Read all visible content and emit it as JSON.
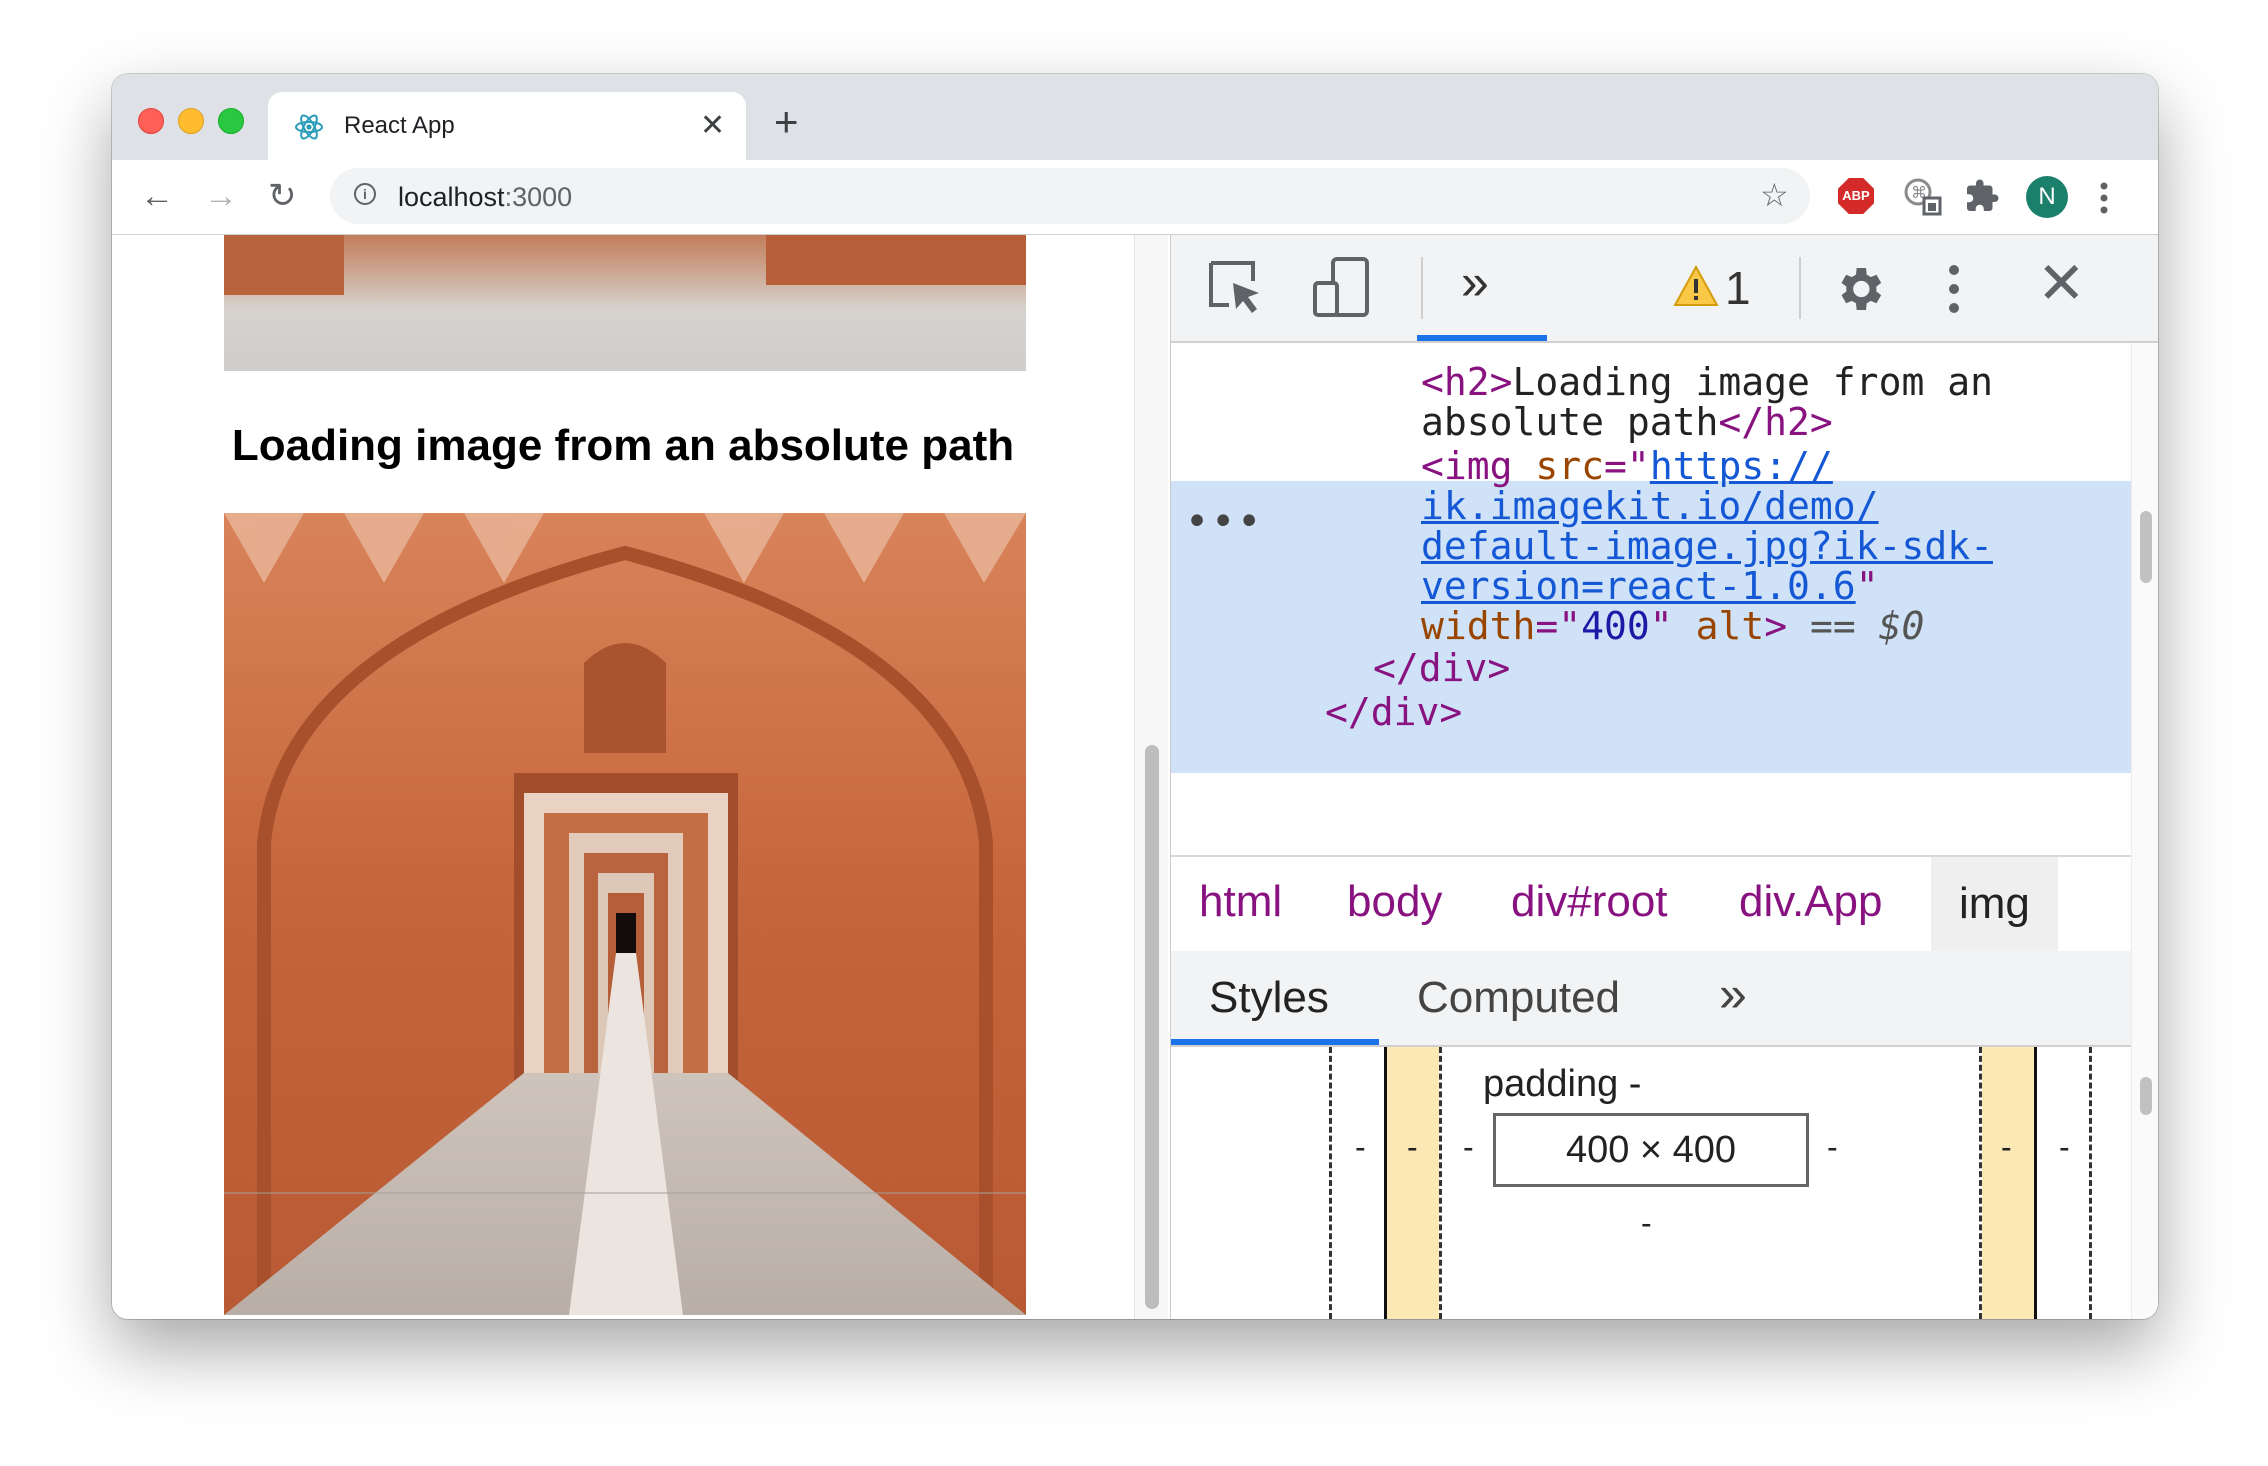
{
  "browser": {
    "tab_title": "React App",
    "url_host": "localhost",
    "url_port": ":3000",
    "avatar_initial": "N",
    "extension_abp": "ABP"
  },
  "page": {
    "heading": "Loading image from an absolute path"
  },
  "devtools": {
    "warning_count": "1",
    "elements": {
      "h2_open": "<h2>",
      "h2_text_1": "Loading image from an",
      "h2_text_2": "absolute path",
      "h2_close": "</h2>",
      "img_open": "<img",
      "src_attr": "src",
      "src_eq": "=\"",
      "src_lines": [
        "https://",
        "ik.imagekit.io/demo/",
        "default-image.jpg?ik-sdk-",
        "version=react-1.0.6"
      ],
      "quote": "\"",
      "width_attr": "width",
      "width_eq": "=\"",
      "width_val": "400",
      "alt_attr": "alt",
      "tag_end": ">",
      "eq_marker": "==",
      "dollar": "$0",
      "div_close_1": "</div>",
      "div_close_2": "</div>",
      "dots": "•••"
    },
    "breadcrumbs": [
      "html",
      "body",
      "div#root",
      "div.App",
      "img"
    ],
    "panel_tabs": [
      "Styles",
      "Computed"
    ],
    "box_model": {
      "padding_label": "padding -",
      "content_size": "400 × 400",
      "dash": "-"
    }
  }
}
